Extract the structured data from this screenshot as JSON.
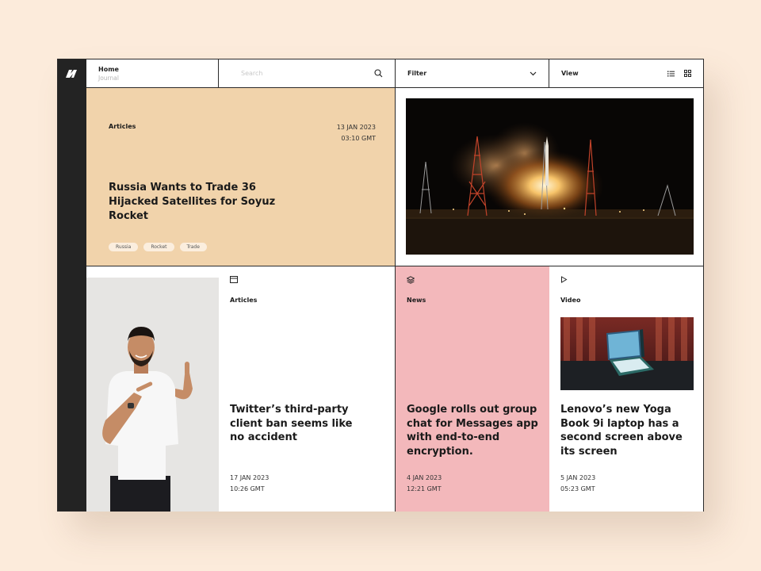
{
  "header": {
    "home_label": "Home",
    "home_sub": "Journal",
    "search_placeholder": "Search",
    "filter_label": "Filter",
    "view_label": "View"
  },
  "hero": {
    "category": "Articles",
    "date": "13 JAN 2023",
    "time": "03:10 GMT",
    "title": "Russia Wants to Trade 36 Hijacked Satellites for Soyuz Rocket",
    "tags": [
      "Russia",
      "Rocket",
      "Trade"
    ]
  },
  "cards": [
    {
      "icon": "browser-window-icon",
      "category": "Articles",
      "title": "Twitter’s third-party client ban seems like no accident",
      "date": "17 JAN 2023",
      "time": "10:26 GMT"
    },
    {
      "icon": "layers-icon",
      "category": "News",
      "title": "Google rolls out group chat for Messages app with end-to-end encryption.",
      "date": "4 JAN 2023",
      "time": "12:21 GMT"
    },
    {
      "icon": "play-icon",
      "category": "Video",
      "title": "Lenovo’s new Yoga Book 9i laptop has a second screen above its screen",
      "date": "5 JAN 2023",
      "time": "05:23 GMT"
    }
  ],
  "colors": {
    "page_bg": "#fcebdb",
    "hero_bg": "#f1d3ab",
    "news_bg": "#f3b8bb",
    "rail_bg": "#232323"
  }
}
